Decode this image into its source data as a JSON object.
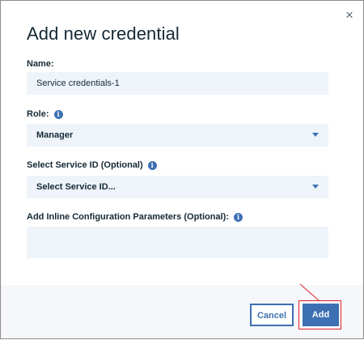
{
  "dialog": {
    "title": "Add new credential",
    "close_glyph": "×",
    "close_icon": "close-icon"
  },
  "fields": {
    "name": {
      "label": "Name:",
      "value": "Service credentials-1"
    },
    "role": {
      "label": "Role:",
      "selected": "Manager"
    },
    "service_id": {
      "label": "Select Service ID (Optional)",
      "selected": "Select Service ID..."
    },
    "inline_config": {
      "label": "Add Inline Configuration Parameters (Optional):",
      "value": ""
    },
    "info_glyph": "i"
  },
  "footer": {
    "cancel_label": "Cancel",
    "add_label": "Add"
  },
  "colors": {
    "accent": "#3d70b2",
    "field_bg": "#eef4fa",
    "footer_bg": "#f5f7fa",
    "annotation_red": "#e0242b"
  }
}
